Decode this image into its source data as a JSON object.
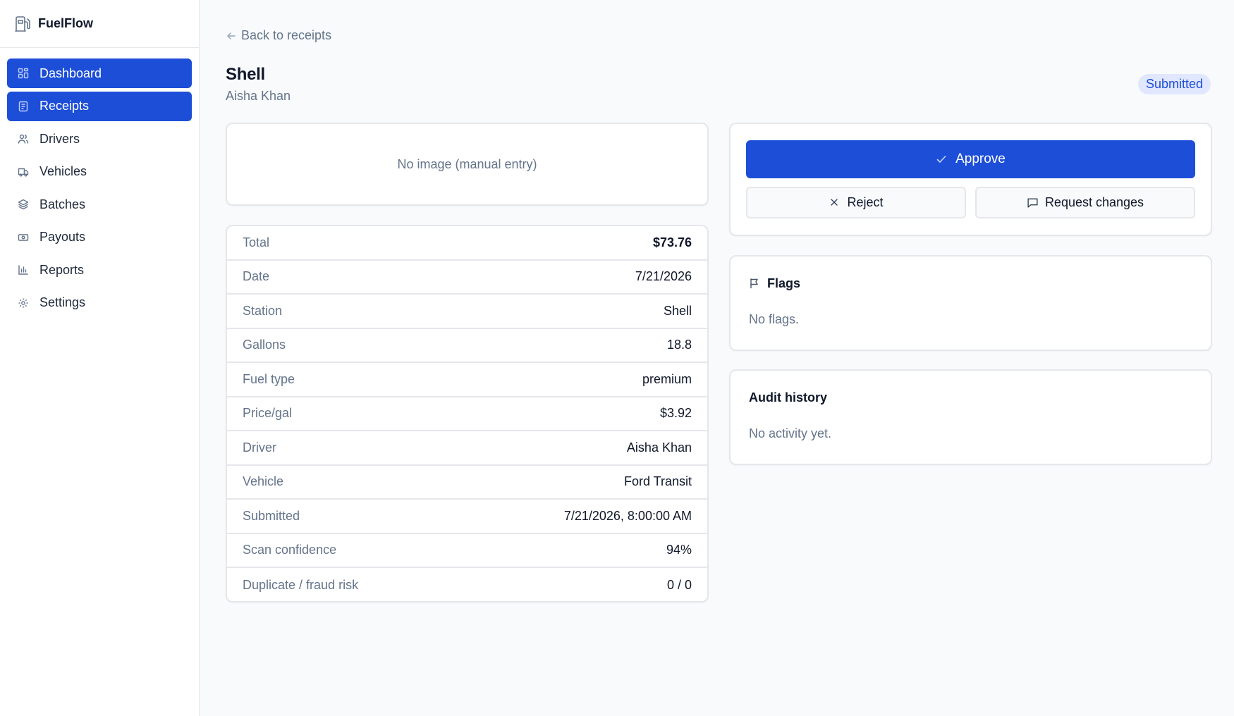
{
  "app": {
    "name": "FuelFlow"
  },
  "sidebar": {
    "items": [
      {
        "label": "Dashboard",
        "icon": "dashboard-icon"
      },
      {
        "label": "Receipts",
        "icon": "receipt-icon"
      },
      {
        "label": "Drivers",
        "icon": "users-icon"
      },
      {
        "label": "Vehicles",
        "icon": "truck-icon"
      },
      {
        "label": "Batches",
        "icon": "layers-icon"
      },
      {
        "label": "Payouts",
        "icon": "banknote-icon"
      },
      {
        "label": "Reports",
        "icon": "bar-chart-icon"
      },
      {
        "label": "Settings",
        "icon": "gear-icon"
      }
    ]
  },
  "header": {
    "back_label": "Back to receipts",
    "title": "Shell",
    "subtitle": "Aisha Khan",
    "status": "Submitted"
  },
  "image_card": {
    "text": "No image (manual entry)"
  },
  "details": [
    {
      "label": "Total",
      "value": "$73.76"
    },
    {
      "label": "Date",
      "value": "7/21/2026"
    },
    {
      "label": "Station",
      "value": "Shell"
    },
    {
      "label": "Gallons",
      "value": "18.8"
    },
    {
      "label": "Fuel type",
      "value": "premium"
    },
    {
      "label": "Price/gal",
      "value": "$3.92"
    },
    {
      "label": "Driver",
      "value": "Aisha Khan"
    },
    {
      "label": "Vehicle",
      "value": "Ford Transit"
    },
    {
      "label": "Submitted",
      "value": "7/21/2026, 8:00:00 AM"
    },
    {
      "label": "Scan confidence",
      "value": "94%"
    },
    {
      "label": "Duplicate / fraud risk",
      "value": "0 / 0"
    }
  ],
  "actions": {
    "approve_label": "Approve",
    "reject_label": "Reject",
    "request_changes_label": "Request changes"
  },
  "flags": {
    "title": "Flags",
    "empty": "No flags."
  },
  "audit": {
    "title": "Audit history",
    "empty": "No activity yet."
  },
  "colors": {
    "accent": "#1d4ed8",
    "badge_bg": "#e0e7ff",
    "muted": "#64748b",
    "border": "#e5e7eb"
  }
}
